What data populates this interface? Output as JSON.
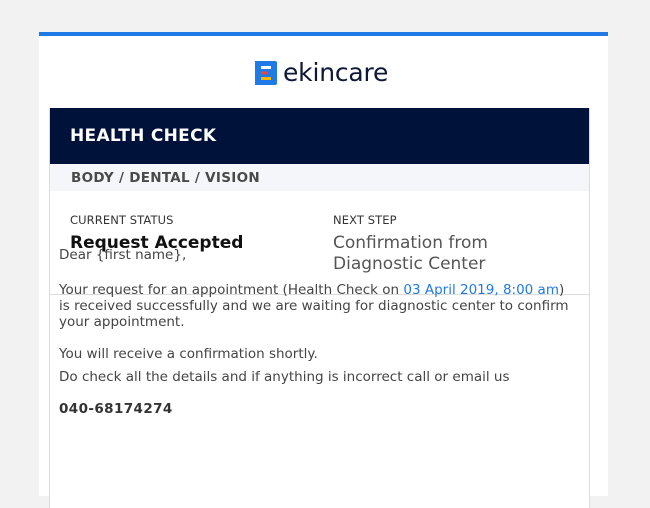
{
  "brand": {
    "name": "ekincare",
    "accent": "#1f7ae8",
    "mark_colors": [
      "#1f7ae8",
      "#e8453c",
      "#f7b500",
      "#34a853"
    ]
  },
  "header": {
    "title": "HEALTH CHECK",
    "subtitle": "BODY / DENTAL / VISION",
    "background": "#00123a"
  },
  "status": {
    "current_label": "CURRENT STATUS",
    "current_value": "Request Accepted",
    "next_label": "NEXT STEP",
    "next_value_line1": "Confirmation from",
    "next_value_line2": "Diagnostic Center"
  },
  "body": {
    "greeting": "Dear {first name},",
    "request_prefix": "Your request for an appointment (Health Check on ",
    "request_date": "03 April 2019, 8:00 am",
    "request_suffix": ") is received successfully and we are waiting for diagnostic center to confirm your appointment.",
    "confirmation": "You will receive a confirmation shortly.",
    "check_details": "Do check all the details and if anything is incorrect call or email us",
    "phone": "040-68174274"
  }
}
